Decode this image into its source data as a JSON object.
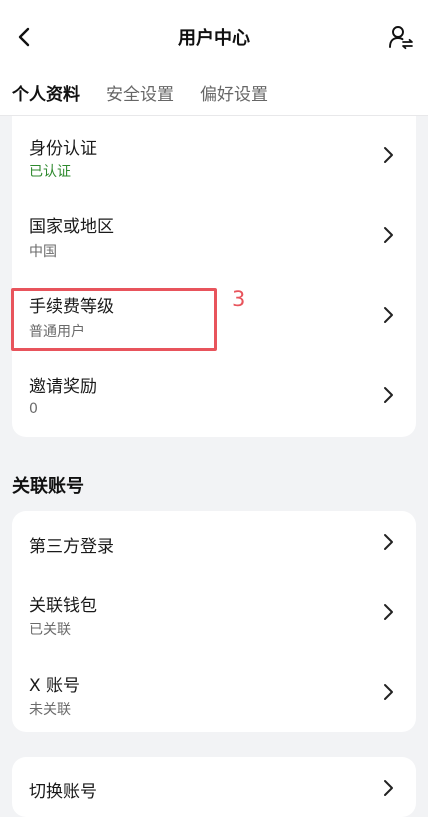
{
  "header": {
    "title": "用户中心",
    "back_icon": "chevron-left-icon",
    "switch_icon": "user-switch-icon"
  },
  "tabs": [
    {
      "label": "个人资料",
      "active": true
    },
    {
      "label": "安全设置",
      "active": false
    },
    {
      "label": "偏好设置",
      "active": false
    }
  ],
  "profile": {
    "items": [
      {
        "label": "身份认证",
        "value": "已认证"
      },
      {
        "label": "国家或地区",
        "value": "中国"
      },
      {
        "label": "手续费等级",
        "value": "普通用户"
      },
      {
        "label": "邀请奖励",
        "value": "0"
      }
    ]
  },
  "linked": {
    "title": "关联账号",
    "items": [
      {
        "label": "第三方登录",
        "value": ""
      },
      {
        "label": "关联钱包",
        "value": "已关联"
      },
      {
        "label": "X 账号",
        "value": "未关联"
      }
    ]
  },
  "switch_account": {
    "label": "切换账号"
  },
  "annotation": {
    "number": "3",
    "color": "#e8545c"
  },
  "colors": {
    "verified": "#2f8a2f",
    "background": "#f2f3f5"
  }
}
